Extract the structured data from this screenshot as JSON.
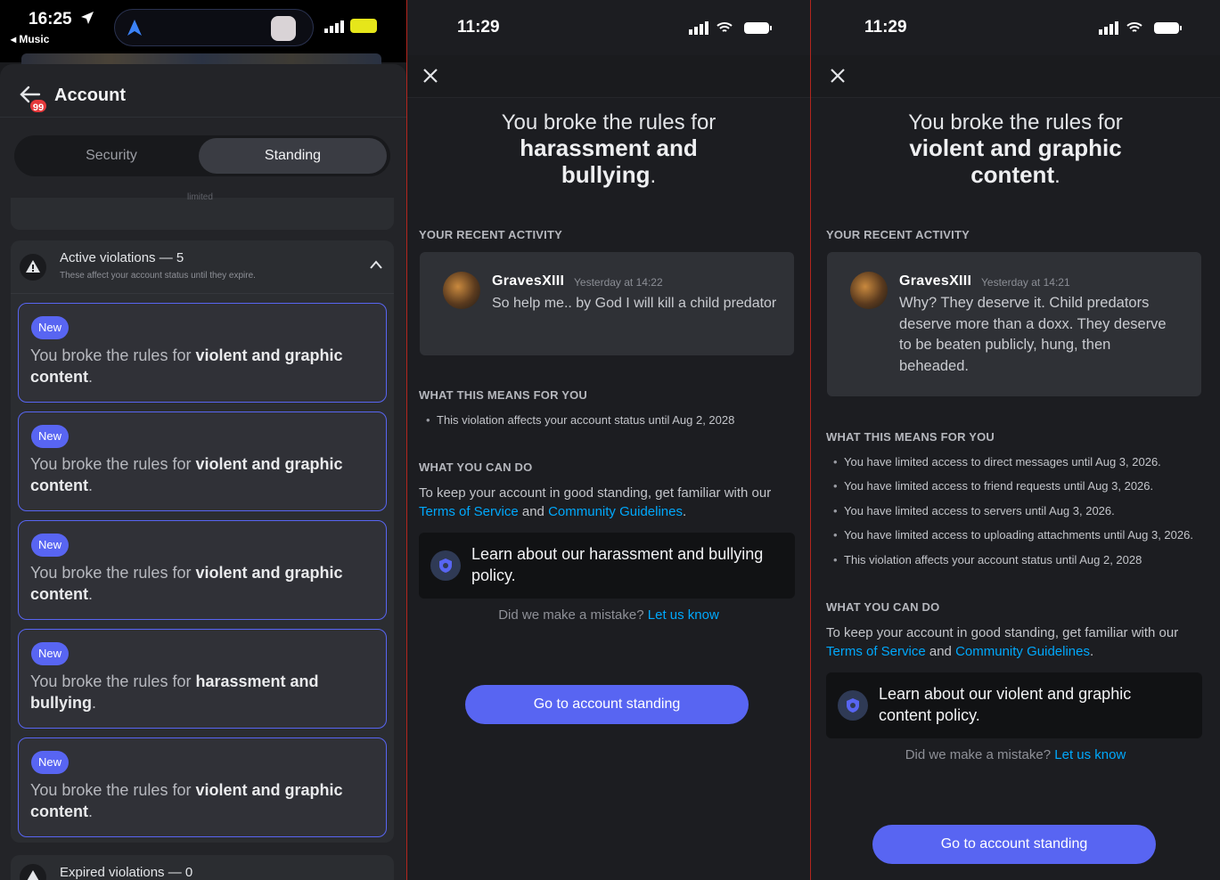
{
  "colors": {
    "accent": "#5865f2",
    "link": "#00a8fc",
    "separator": "#b3261e"
  },
  "panel1": {
    "status": {
      "time": "16:25",
      "back_app": "◂ Music",
      "badge_icon": "location-arrow-icon"
    },
    "header": {
      "title": "Account",
      "badge": "99"
    },
    "tabs": [
      {
        "label": "Security"
      },
      {
        "label": "Standing"
      }
    ],
    "stub_text": "limited",
    "active": {
      "title": "Active violations — 5",
      "subtitle": "These affect your account status until they expire."
    },
    "cards": [
      {
        "badge": "New",
        "prefix": "You broke the rules for ",
        "bold": "violent and graphic content",
        "suffix": "."
      },
      {
        "badge": "New",
        "prefix": "You broke the rules for ",
        "bold": "violent and graphic content",
        "suffix": "."
      },
      {
        "badge": "New",
        "prefix": "You broke the rules for ",
        "bold": "violent and graphic content",
        "suffix": "."
      },
      {
        "badge": "New",
        "prefix": "You broke the rules for ",
        "bold": "harassment and bullying",
        "suffix": "."
      },
      {
        "badge": "New",
        "prefix": "You broke the rules for ",
        "bold": "violent and graphic content",
        "suffix": "."
      }
    ],
    "expired": {
      "title": "Expired violations — 0"
    }
  },
  "panel2": {
    "time": "11:29",
    "heading": {
      "line1": "You broke the rules for",
      "bold": "harassment and bullying",
      "suffix": "."
    },
    "recent_label": "YOUR RECENT ACTIVITY",
    "message": {
      "user": "GravesXIII",
      "time": "Yesterday at 14:22",
      "text": "So help me.. by God I will kill a child predator"
    },
    "means_label": "WHAT THIS MEANS FOR YOU",
    "means": [
      "This violation affects your account status until Aug 2, 2028"
    ],
    "can_do_label": "WHAT YOU CAN DO",
    "can_do": {
      "text": "To keep your account in good standing, get familiar with our",
      "tos": "Terms of Service",
      "and": "and",
      "guidelines": "Community Guidelines",
      "end": "."
    },
    "learn": "Learn about our harassment and bullying policy.",
    "mistake": {
      "text": "Did we make a mistake?",
      "link": "Let us know"
    },
    "cta": "Go to account standing"
  },
  "panel3": {
    "time": "11:29",
    "heading": {
      "line1": "You broke the rules for",
      "bold": "violent and graphic content",
      "suffix": "."
    },
    "recent_label": "YOUR RECENT ACTIVITY",
    "message": {
      "user": "GravesXIII",
      "time": "Yesterday at 14:21",
      "text": "Why? They deserve it. Child predators deserve more than a doxx. They deserve to be beaten publicly, hung, then beheaded."
    },
    "means_label": "WHAT THIS MEANS FOR YOU",
    "means": [
      "You have limited access to direct messages until Aug 3, 2026.",
      "You have limited access to friend requests until Aug 3, 2026.",
      "You have limited access to servers until Aug 3, 2026.",
      "You have limited access to uploading attachments until Aug 3, 2026.",
      "This violation affects your account status until Aug 2, 2028"
    ],
    "can_do_label": "WHAT YOU CAN DO",
    "can_do": {
      "text": "To keep your account in good standing, get familiar with our",
      "tos": "Terms of Service",
      "and": "and",
      "guidelines": "Community Guidelines",
      "end": "."
    },
    "learn": "Learn about our violent and graphic content policy.",
    "mistake": {
      "text": "Did we make a mistake?",
      "link": "Let us know"
    },
    "cta": "Go to account standing"
  }
}
